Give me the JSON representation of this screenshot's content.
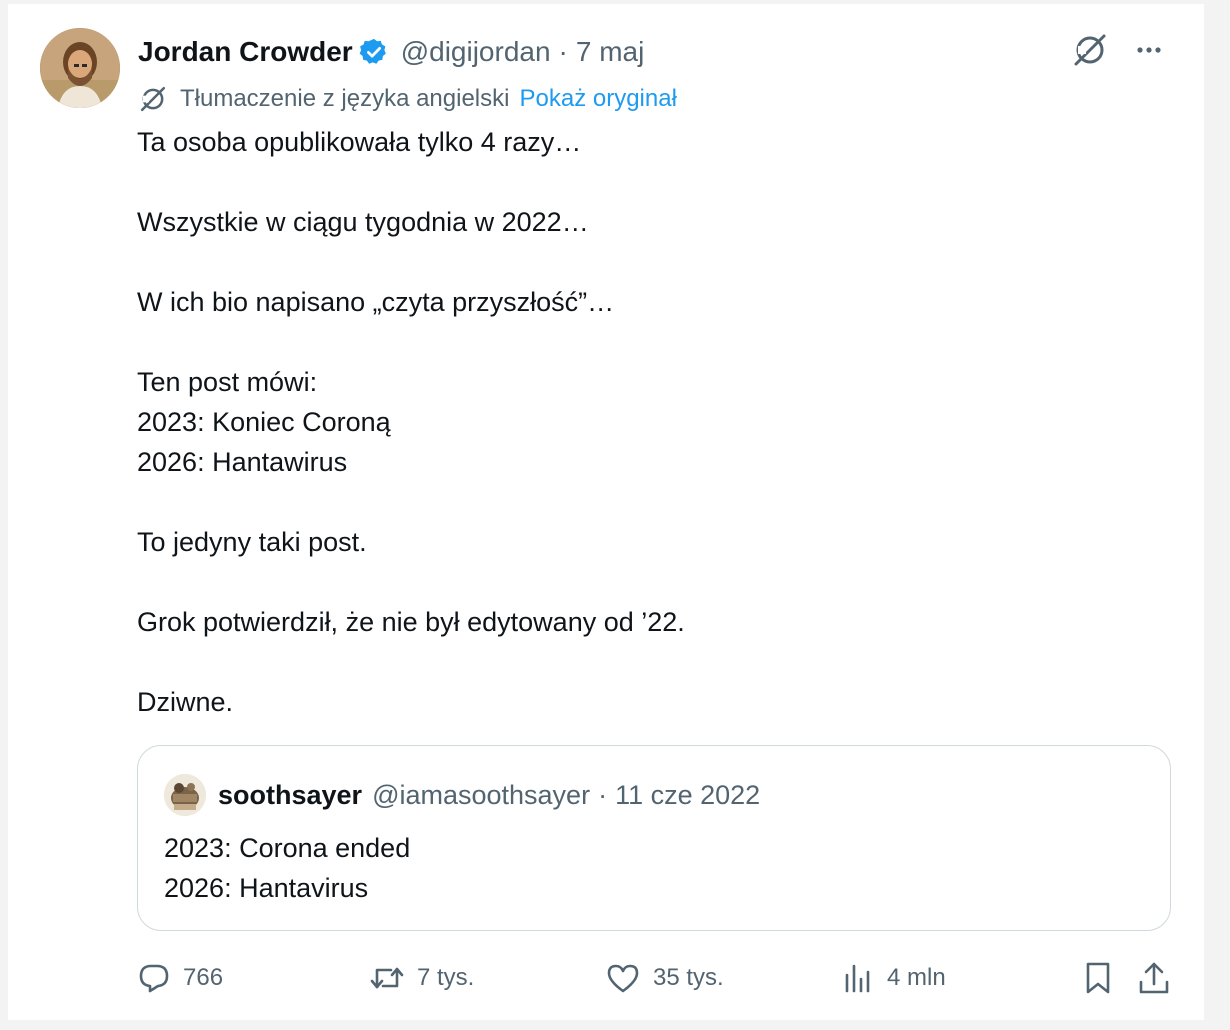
{
  "post": {
    "author": {
      "name": "Jordan Crowder",
      "handle": "@digijordan",
      "date": "7 maj",
      "separator": "·"
    },
    "translation": {
      "label": "Tłumaczenie z języka angielski",
      "show_original": "Pokaż oryginał"
    },
    "body": [
      "Ta osoba opublikowała tylko 4 razy…",
      "",
      "Wszystkie w ciągu tygodnia w 2022…",
      "",
      "W ich bio napisano „czyta przyszłość”…",
      "",
      "Ten post mówi:",
      "2023: Koniec Coroną",
      "2026: Hantawirus",
      "",
      "To jedyny taki post.",
      "",
      "Grok potwierdził, że nie był edytowany od ’22.",
      "",
      "Dziwne."
    ]
  },
  "quote": {
    "name": "soothsayer",
    "handle": "@iamasoothsayer",
    "separator": "·",
    "date": "11 cze 2022",
    "body": [
      "2023: Corona ended",
      "2026: Hantavirus"
    ]
  },
  "actions": {
    "replies": "766",
    "reposts": "7 tys.",
    "likes": "35 tys.",
    "views": "4 mln"
  },
  "colors": {
    "accent": "#1d9bf0",
    "secondary_text": "#536471",
    "primary_text": "#0f1419",
    "border": "#cfd9de"
  },
  "icons": {
    "verified": "verified-badge-icon",
    "grok": "grok-icon",
    "more": "more-icon",
    "translate": "translate-icon",
    "reply": "reply-icon",
    "repost": "repost-icon",
    "like": "like-icon",
    "views": "views-icon",
    "bookmark": "bookmark-icon",
    "share": "share-icon"
  }
}
